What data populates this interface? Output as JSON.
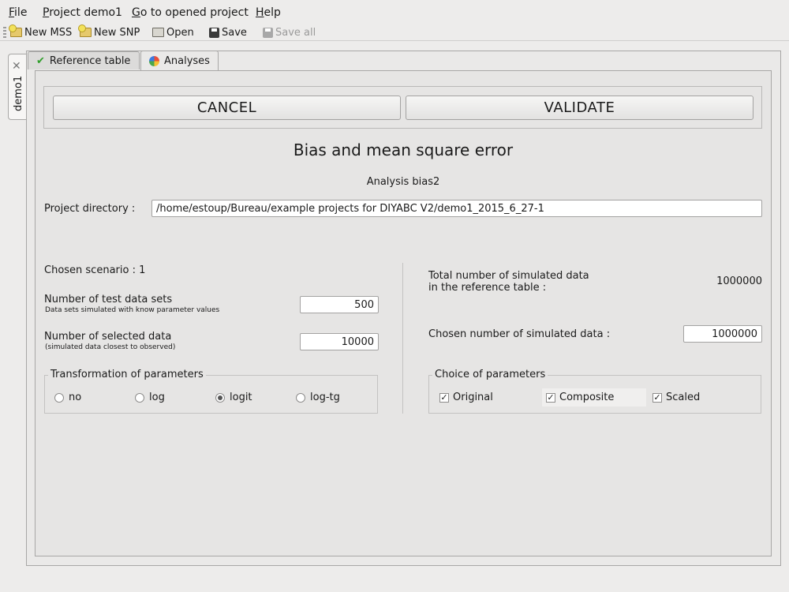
{
  "menubar": {
    "items": [
      {
        "label": "File",
        "mnemonic": "F",
        "rest": "ile"
      },
      {
        "label": "Project demo1",
        "mnemonic": "P",
        "rest": "roject demo1"
      },
      {
        "label": "Go to opened project",
        "mnemonic": "G",
        "rest": "o to opened project"
      },
      {
        "label": "Help",
        "mnemonic": "H",
        "rest": "elp"
      }
    ]
  },
  "toolbar": {
    "new_mss": "New MSS",
    "new_snp": "New SNP",
    "open": "Open",
    "save": "Save",
    "save_all": "Save all"
  },
  "project_tab": {
    "label": "demo1",
    "close_icon": "close-icon"
  },
  "tabs": [
    {
      "label": "Reference table",
      "icon": "checkmark-icon",
      "active": false
    },
    {
      "label": "Analyses",
      "icon": "pie-icon",
      "active": true
    }
  ],
  "buttons": {
    "cancel": "CANCEL",
    "validate": "VALIDATE"
  },
  "page": {
    "title": "Bias and mean square error",
    "analysis": "Analysis  bias2"
  },
  "project_directory": {
    "label": "Project directory :",
    "value": "/home/estoup/Bureau/example projects for DIYABC V2/demo1_2015_6_27-1"
  },
  "left": {
    "chosen_scenario": "Chosen scenario : 1",
    "test_sets_label": "Number of test data sets",
    "test_sets_hint": "Data sets simulated with know parameter values",
    "test_sets_value": "500",
    "selected_label": "Number of selected data",
    "selected_hint": "(simulated data closest to observed)",
    "selected_value": "10000",
    "transformation": {
      "title": "Transformation of parameters",
      "options": [
        {
          "label": "no",
          "checked": false
        },
        {
          "label": "log",
          "checked": false
        },
        {
          "label": "logit",
          "checked": true
        },
        {
          "label": "log-tg",
          "checked": false
        }
      ]
    }
  },
  "right": {
    "total_label_line1": "Total number of simulated data",
    "total_label_line2": "in the reference table :",
    "total_value": "1000000",
    "chosen_label": "Chosen number of simulated data :",
    "chosen_value": "1000000",
    "choice": {
      "title": "Choice of parameters",
      "options": [
        {
          "label": "Original",
          "checked": true
        },
        {
          "label": "Composite",
          "checked": true
        },
        {
          "label": "Scaled",
          "checked": true
        }
      ]
    }
  }
}
